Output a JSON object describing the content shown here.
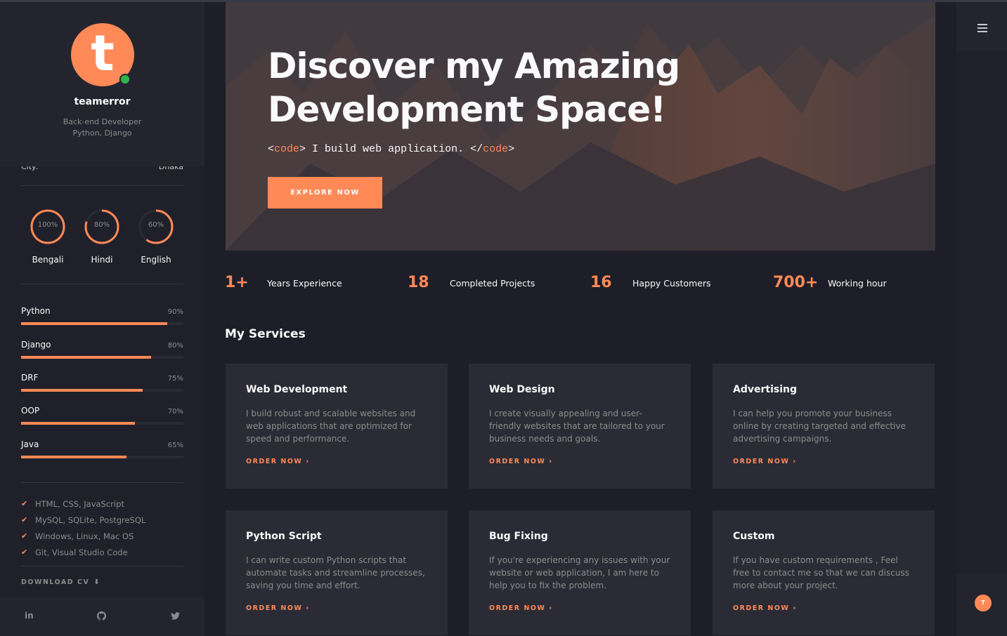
{
  "profile": {
    "avatar_letter": "t",
    "name": "teamerror",
    "role_line1": "Back-end Developer",
    "role_line2": "Python, Django",
    "city_label": "City:",
    "city_value": "Dhaka"
  },
  "languages": [
    {
      "name": "Bengali",
      "pct_label": "100%",
      "value": 1.0
    },
    {
      "name": "Hindi",
      "pct_label": "80%",
      "value": 0.8
    },
    {
      "name": "English",
      "pct_label": "60%",
      "value": 0.6
    }
  ],
  "skills": [
    {
      "name": "Python",
      "pct_label": "90%",
      "value": 0.9
    },
    {
      "name": "Django",
      "pct_label": "80%",
      "value": 0.8
    },
    {
      "name": "DRF",
      "pct_label": "75%",
      "value": 0.75
    },
    {
      "name": "OOP",
      "pct_label": "70%",
      "value": 0.7
    },
    {
      "name": "Java",
      "pct_label": "65%",
      "value": 0.65
    }
  ],
  "tools": [
    "HTML, CSS, JavaScript",
    "MySQL, SQLite, PostgreSQL",
    "Windows, Linux, Mac OS",
    "Git, Visual Studio Code"
  ],
  "download_cv": "DOWNLOAD CV",
  "social": {
    "linkedin": "in",
    "github": "github",
    "twitter": "twitter"
  },
  "hero": {
    "title_line1": "Discover my Amazing",
    "title_line2": "Development Space!",
    "code_open_lt": "<",
    "code_tag": "code",
    "code_open_gt": ">",
    "code_text": " I build web application. ",
    "code_close_lt": "</",
    "code_close_gt": ">",
    "button": "EXPLORE NOW"
  },
  "stats": [
    {
      "number": "1+",
      "label": "Years Experience"
    },
    {
      "number": "18",
      "label": "Completed Projects"
    },
    {
      "number": "16",
      "label": "Happy Customers"
    },
    {
      "number": "700+",
      "label": "Working hour"
    }
  ],
  "services_title": "My Services",
  "services": [
    {
      "title": "Web Development",
      "text": "I build robust and scalable websites and web applications that are optimized for speed and performance.",
      "link": "ORDER NOW"
    },
    {
      "title": "Web Design",
      "text": "I create visually appealing and user-friendly websites that are tailored to your business needs and goals.",
      "link": "ORDER NOW"
    },
    {
      "title": "Advertising",
      "text": "I can help you promote your business online by creating targeted and effective advertising campaigns.",
      "link": "ORDER NOW"
    },
    {
      "title": "Python Script",
      "text": "I can write custom Python scripts that automate tasks and streamline processes, saving you time and effort.",
      "link": "ORDER NOW"
    },
    {
      "title": "Bug Fixing",
      "text": "If you're experiencing any issues with your website or web application, I am here to help you to fix the problem.",
      "link": "ORDER NOW"
    },
    {
      "title": "Custom",
      "text": "If you have custom requirements , Feel free to contact me so that we can discuss more about your project.",
      "link": "ORDER NOW"
    }
  ],
  "rail": {
    "mini_avatar_letter": "T"
  },
  "colors": {
    "accent": "#ff8a57",
    "background": "#1e1e28",
    "card": "#2b2b35",
    "online": "#2fb54a"
  }
}
